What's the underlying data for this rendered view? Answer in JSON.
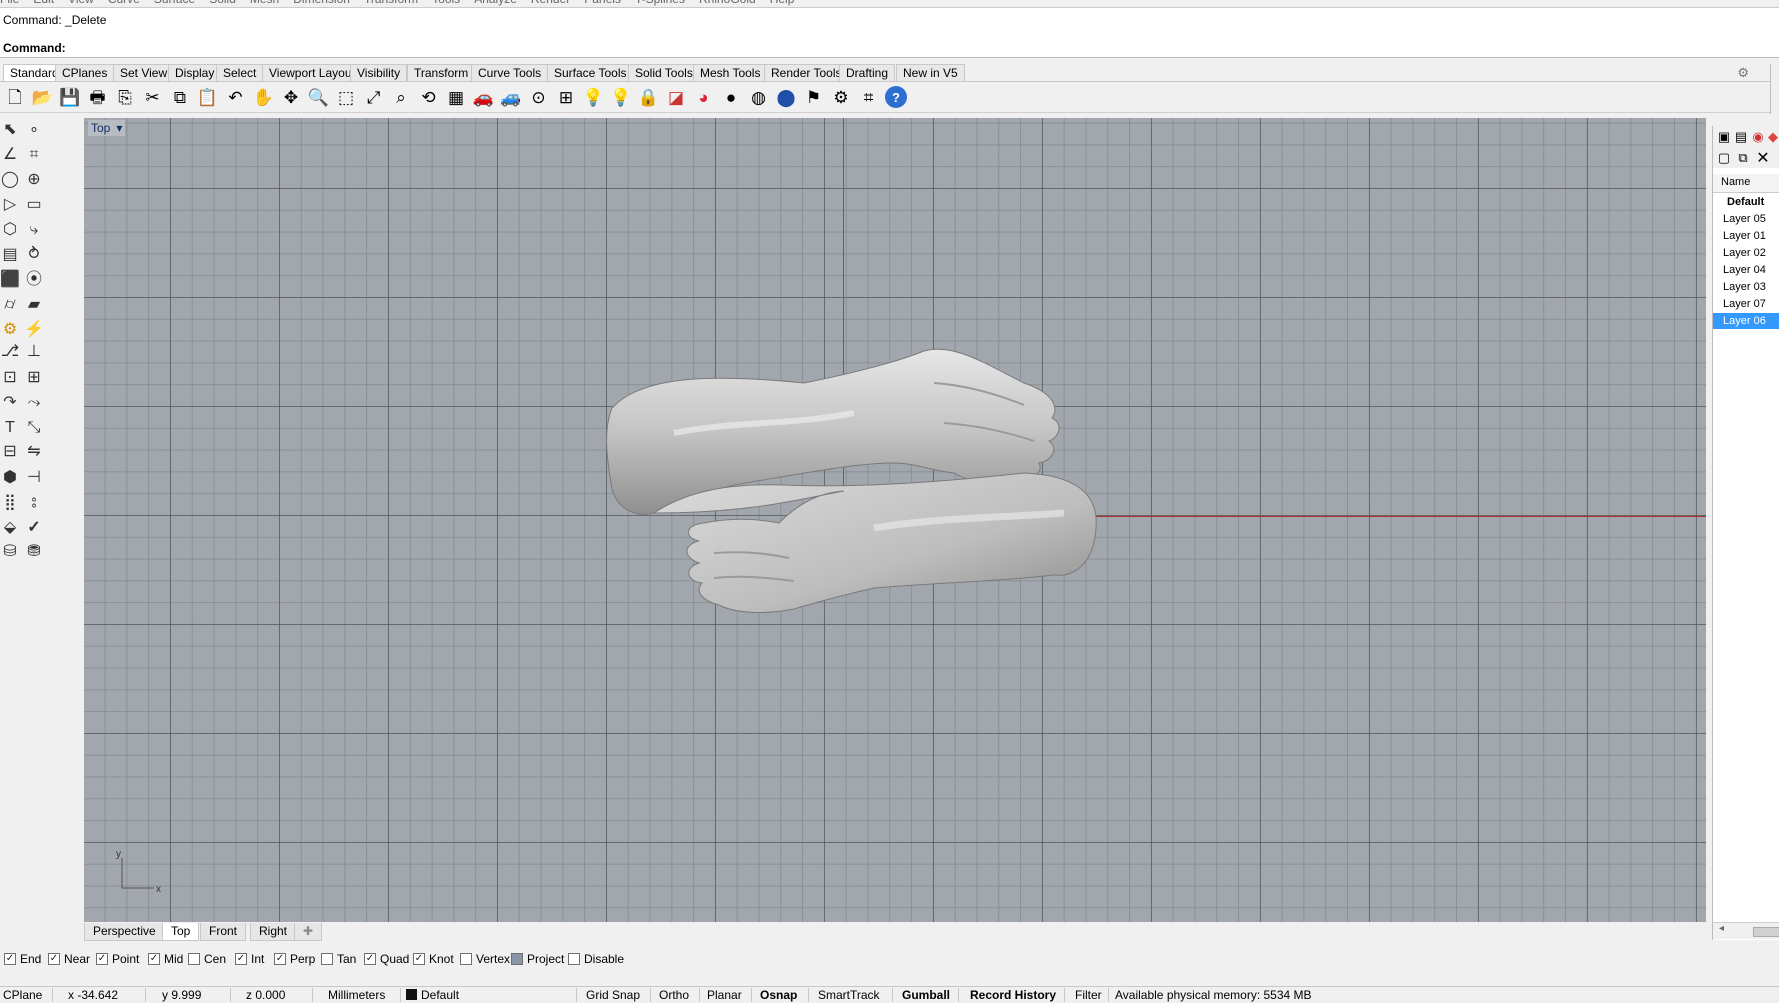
{
  "menu": [
    "File",
    "Edit",
    "View",
    "Curve",
    "Surface",
    "Solid",
    "Mesh",
    "Dimension",
    "Transform",
    "Tools",
    "Analyze",
    "Render",
    "Panels",
    "T-Splines",
    "RhinoGold",
    "Help"
  ],
  "command": {
    "history": "Command: _Delete",
    "prompt": "Command:"
  },
  "toolbar_tabs": [
    "Standard",
    "CPlanes",
    "Set View",
    "Display",
    "Select",
    "Viewport Layout",
    "Visibility",
    "Transform",
    "Curve Tools",
    "Surface Tools",
    "Solid Tools",
    "Mesh Tools",
    "Render Tools",
    "Drafting",
    "New in V5"
  ],
  "toolbar_icons": [
    "new-icon",
    "open-icon",
    "save-icon",
    "print-icon",
    "import-icon",
    "cut-icon",
    "copy-icon",
    "paste-icon",
    "undo-icon",
    "pan-icon",
    "move-view-icon",
    "zoom-icon",
    "zoom-window-icon",
    "zoom-extents-icon",
    "zoom-selected-icon",
    "rotate-view-icon",
    "four-viewports-icon",
    "car-icon",
    "car-alt-icon",
    "point-icon",
    "mesh-icon",
    "light-icon",
    "light-alt-icon",
    "lock-icon",
    "material-icon",
    "color-wheel-icon",
    "sphere-icon",
    "sphere-alt-icon",
    "sphere-blue-icon",
    "flag-icon",
    "gear-icon",
    "snap-icon",
    "help-icon"
  ],
  "viewport": {
    "name": "Top",
    "axis_x": "x",
    "axis_y": "y",
    "colors": {
      "background": "#a2a7ad",
      "x_axis": "#b03030",
      "y_axis": "#2e8b2e"
    }
  },
  "viewport_tabs": [
    "Perspective",
    "Top",
    "Front",
    "Right"
  ],
  "osnap": [
    {
      "label": "End",
      "checked": true
    },
    {
      "label": "Near",
      "checked": true
    },
    {
      "label": "Point",
      "checked": true
    },
    {
      "label": "Mid",
      "checked": true
    },
    {
      "label": "Cen",
      "checked": false
    },
    {
      "label": "Int",
      "checked": true
    },
    {
      "label": "Perp",
      "checked": true
    },
    {
      "label": "Tan",
      "checked": false
    },
    {
      "label": "Quad",
      "checked": true
    },
    {
      "label": "Knot",
      "checked": true
    },
    {
      "label": "Vertex",
      "checked": false
    },
    {
      "label": "Project",
      "checked": true
    },
    {
      "label": "Disable",
      "checked": false
    }
  ],
  "status": {
    "cplane": "CPlane",
    "x": "x -34.642",
    "y": "y 9.999",
    "z": "z 0.000",
    "units": "Millimeters",
    "layer": "Default",
    "grid_snap": "Grid Snap",
    "ortho": "Ortho",
    "planar": "Planar",
    "osnap": "Osnap",
    "smarttrack": "SmartTrack",
    "gumball": "Gumball",
    "record_history": "Record History",
    "filter": "Filter",
    "memory": "Available physical memory: 5534 MB"
  },
  "layers_panel": {
    "column": "Name",
    "layers": [
      {
        "name": "Default",
        "bold": true,
        "selected": false
      },
      {
        "name": "Layer 05",
        "bold": false,
        "selected": false
      },
      {
        "name": "Layer 01",
        "bold": false,
        "selected": false
      },
      {
        "name": "Layer 02",
        "bold": false,
        "selected": false
      },
      {
        "name": "Layer 04",
        "bold": false,
        "selected": false
      },
      {
        "name": "Layer 03",
        "bold": false,
        "selected": false
      },
      {
        "name": "Layer 07",
        "bold": false,
        "selected": false
      },
      {
        "name": "Layer 06",
        "bold": false,
        "selected": true
      }
    ]
  }
}
